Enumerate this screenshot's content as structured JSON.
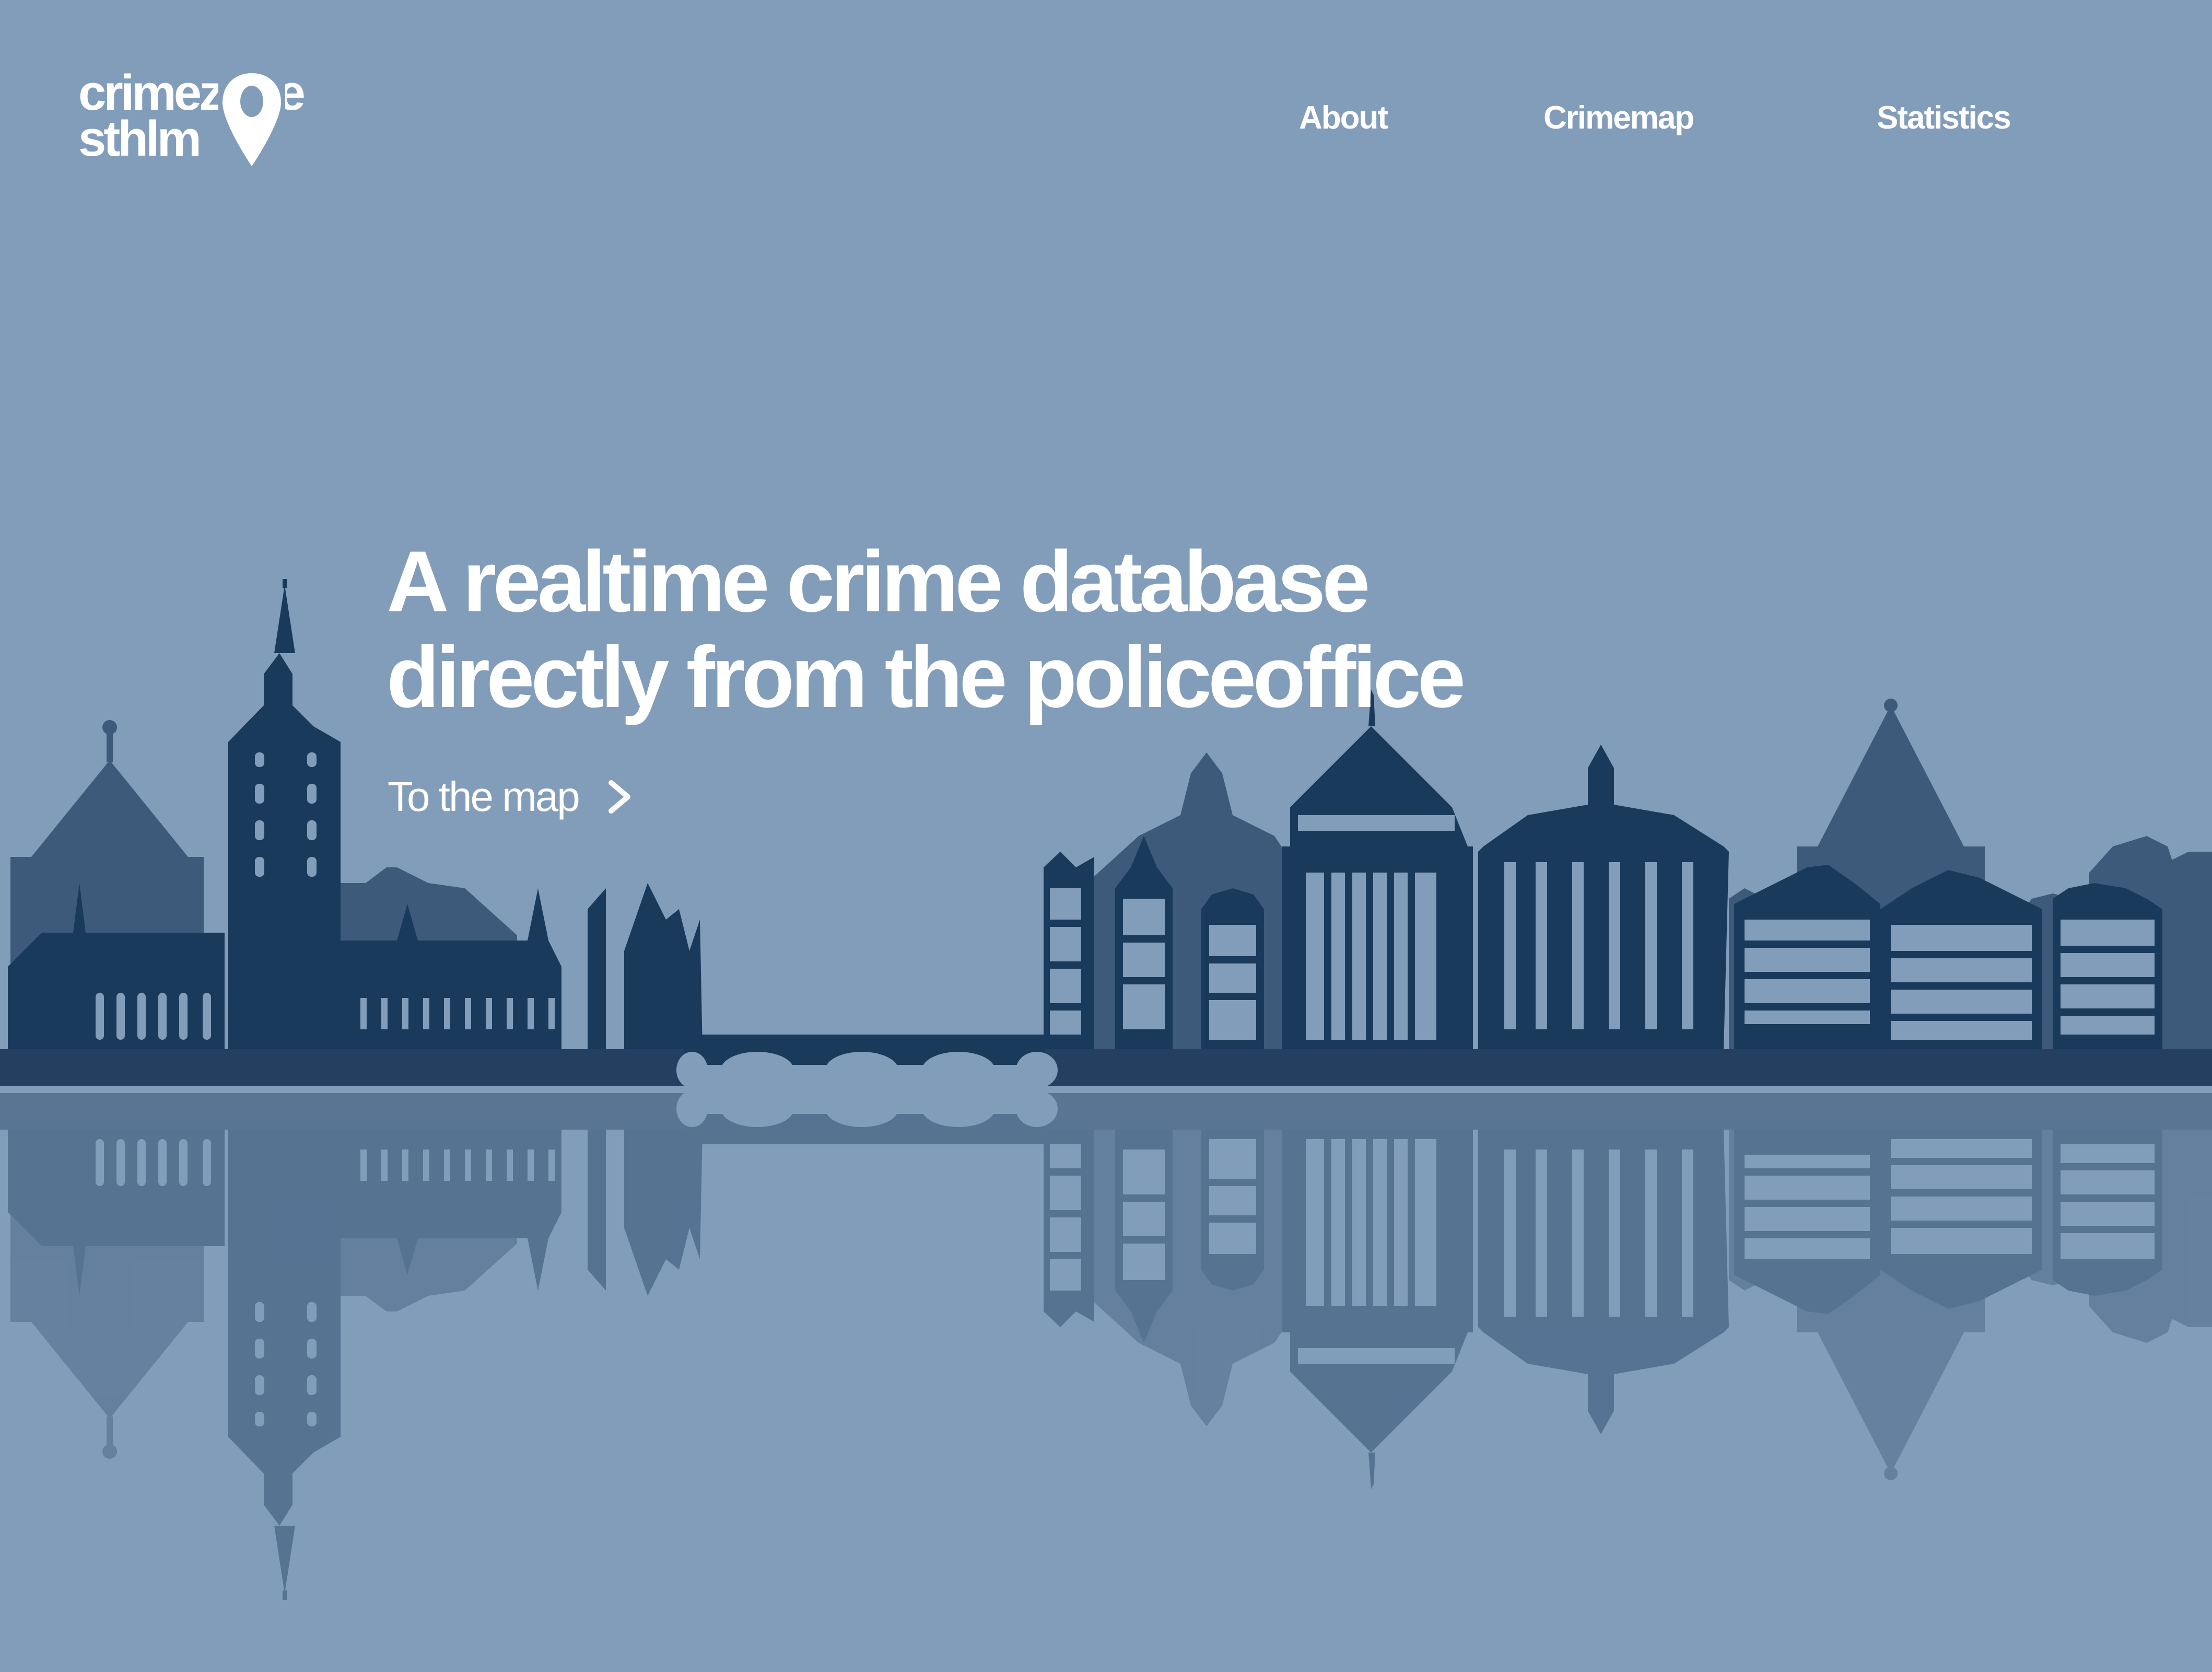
{
  "brand": {
    "line1": "crimezone",
    "line2": "sthlm",
    "pin_icon": "location-pin-icon"
  },
  "nav": {
    "items": [
      {
        "label": "About"
      },
      {
        "label": "Crimemap"
      },
      {
        "label": "Statistics"
      }
    ]
  },
  "hero": {
    "headline_line1": "A realtime crime database",
    "headline_line2": "directly from the policeoffice",
    "cta_label": "To the map",
    "cta_icon": "chevron-right-icon",
    "illustration": "stockholm-skyline-reflection"
  },
  "colors": {
    "background": "#829dba",
    "building_dark": "#1a3a5c",
    "building_mid": "#3e5a7a",
    "reflection": "#5f7b9b",
    "text": "#ffffff"
  }
}
